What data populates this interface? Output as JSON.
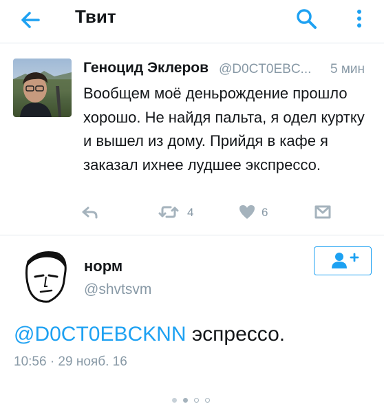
{
  "header": {
    "title": "Твит"
  },
  "tweet": {
    "author_name": "Геноцид Эклеров",
    "author_handle": "@D0CT0EBC...",
    "time": "5 мин",
    "text": "Вообщем моё деньрождение прошло хорошо. Не найдя пальта, я одел куртку и вышел из дому. Прийдя в кафе я заказал ихнее лудшее экспрессо.",
    "retweets": "4",
    "likes": "6"
  },
  "reply": {
    "author_name": "норм",
    "author_handle": "@shvtsvm",
    "mention": "@D0CT0EBCKNN",
    "text": " эспрессо.",
    "timestamp": "10:56 · 29 нояб. 16"
  },
  "colors": {
    "accent": "#1da1f2",
    "muted": "#8899a6",
    "text": "#14171a",
    "divider": "#e1e8ed"
  },
  "icons": [
    "back-arrow-icon",
    "search-icon",
    "more-vert-icon",
    "reply-icon",
    "retweet-icon",
    "heart-icon",
    "message-icon",
    "add-user-icon"
  ]
}
